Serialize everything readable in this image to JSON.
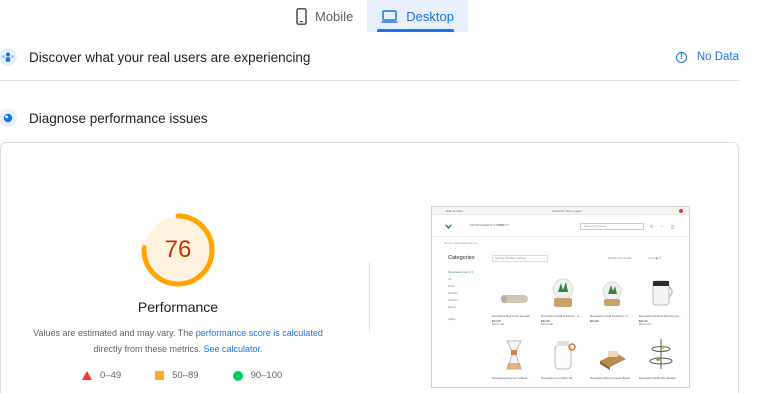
{
  "tabs": [
    {
      "label": "Mobile",
      "active": false,
      "icon": "phone-icon"
    },
    {
      "label": "Desktop",
      "active": true,
      "icon": "laptop-icon"
    }
  ],
  "field_data": {
    "title": "Discover what your real users are experiencing",
    "status": "No Data",
    "icon": "users-icon"
  },
  "lab_data": {
    "title": "Diagnose performance issues",
    "icon": "lab-icon"
  },
  "report": {
    "score": "76",
    "score_fraction": 0.76,
    "category": "Performance",
    "desc_prefix": "Values are estimated and may vary. The ",
    "desc_link1": "performance score is calculated",
    "desc_mid": " directly from these metrics. ",
    "desc_link2": "See calculator.",
    "legend": [
      {
        "range": "0–49",
        "shape": "triangle",
        "color": "#ff3333"
      },
      {
        "range": "50–89",
        "shape": "square",
        "color": "#ffaa33"
      },
      {
        "range": "90–100",
        "shape": "circle",
        "color": "#00cc66"
      }
    ]
  },
  "colors": {
    "accent": "#1a73e8",
    "average": "#ffa400",
    "score_text": "#c33300"
  },
  "screenshot": {
    "topbar_left": "Sale & Clear",
    "topbar_center": "Featured: Store pages",
    "nav_links": [
      "MICROGREENS STORE",
      "UTILITY"
    ],
    "search_placeholder": "Search for items",
    "breadcrumb": "Home  /  Decorative items",
    "categories_title": "Categories",
    "side_links": [
      "Decorative Items ▾",
      "All",
      "New",
      "Garden",
      "Kitchen",
      "Décor",
      "Utility"
    ],
    "side_bottom": "Utility",
    "sort_label": "Sort by: Default sorting",
    "show_label": "Showing 8 results",
    "view_label": "View  ▦  ☰",
    "products": [
      {
        "name": "Decorative Rug Linen Wooden",
        "price": "$24.00",
        "sub": "Add to cart"
      },
      {
        "name": "Decorative Small Terrarium - Is…",
        "price": "$32.00",
        "sub": "Add to cart"
      },
      {
        "name": "Decorative Small Terrarium - It…",
        "price": "$24.00",
        "sub": ""
      },
      {
        "name": "Decorative Ceramic Brewing Sy…",
        "price": "$32.00",
        "sub": "Add to cart"
      },
      {
        "name": "Decorative Chemex Coffeem…",
        "price": "",
        "sub": ""
      },
      {
        "name": "Decorative 1 Lt Kilner Jar",
        "price": "",
        "sub": ""
      },
      {
        "name": "Decorative Wood Cheese Board",
        "price": "",
        "sub": ""
      },
      {
        "name": "Decorative Metal Wire Basket",
        "price": "",
        "sub": ""
      }
    ]
  }
}
